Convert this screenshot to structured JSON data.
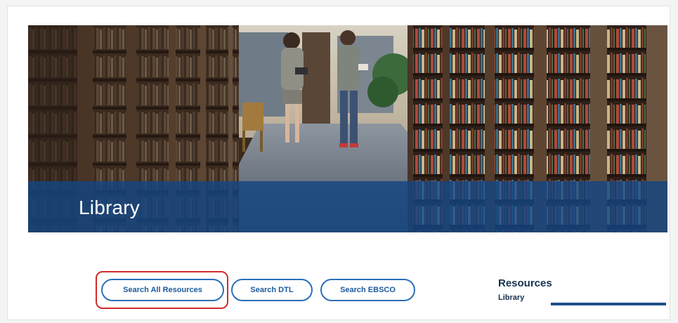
{
  "hero": {
    "title": "Library",
    "image": "library-aisle-photo",
    "band_color": "#14468299"
  },
  "search_buttons": [
    {
      "label": "Search All Resources",
      "highlighted": true
    },
    {
      "label": "Search DTL",
      "highlighted": false
    },
    {
      "label": "Search EBSCO",
      "highlighted": false
    }
  ],
  "resources": {
    "title": "Resources",
    "subtitle": "Library"
  },
  "colors": {
    "accent": "#2a6fb8",
    "highlight": "#d22b2b",
    "band": "#144682",
    "heading": "#16314f"
  }
}
